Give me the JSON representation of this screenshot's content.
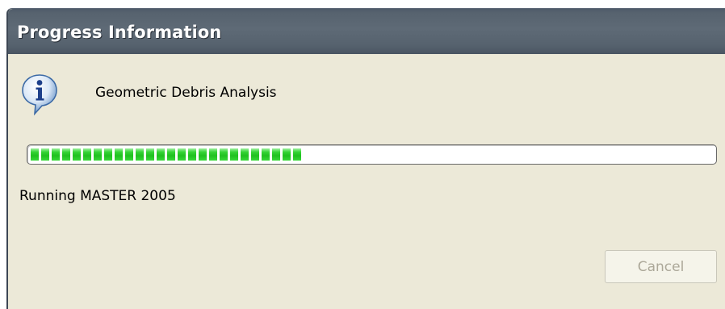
{
  "window": {
    "title": "Progress Information"
  },
  "dialog": {
    "icon": "info-icon",
    "message": "Geometric Debris Analysis",
    "progress_percent": 40,
    "status_text": "Running MASTER 2005",
    "cancel_label": "Cancel",
    "cancel_enabled": false
  },
  "colors": {
    "titlebar": "#5e6a76",
    "progress_fill": "#35d435",
    "dialog_background": "#ece9d8",
    "disabled_text": "#aca899"
  }
}
